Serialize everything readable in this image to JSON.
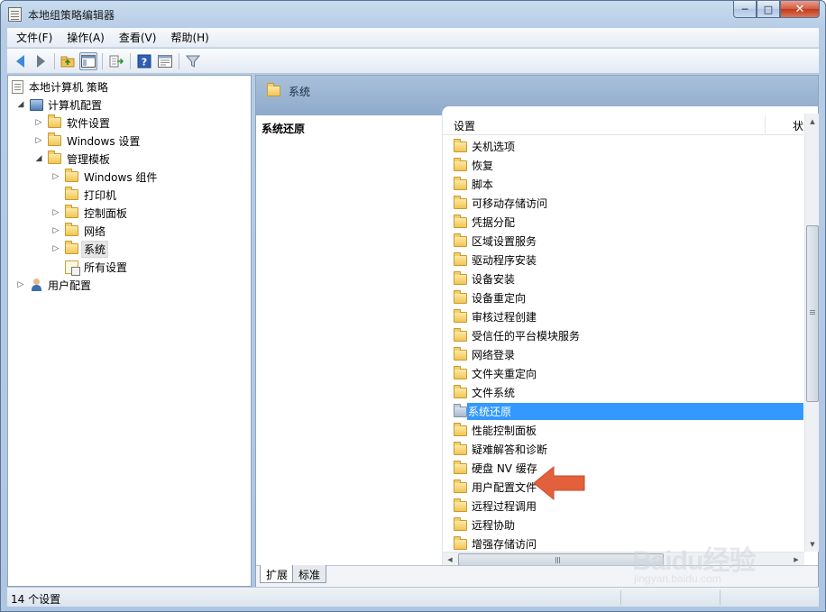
{
  "window": {
    "title": "本地组策略编辑器",
    "caption": {
      "minimize": "─",
      "maximize": "□",
      "close": "✕"
    }
  },
  "menu": [
    {
      "label": "文件(F)"
    },
    {
      "label": "操作(A)"
    },
    {
      "label": "查看(V)"
    },
    {
      "label": "帮助(H)"
    }
  ],
  "toolbar": {
    "icons": [
      "back-icon",
      "forward-icon",
      "up-folder-icon",
      "show-hide-tree-icon",
      "export-list-icon",
      "help-icon",
      "properties-icon",
      "filter-icon"
    ]
  },
  "tree": {
    "root": "本地计算机 策略",
    "computer_config": "计算机配置",
    "software_settings": "软件设置",
    "windows_settings": "Windows 设置",
    "admin_templates": "管理模板",
    "windows_components": "Windows 组件",
    "printers": "打印机",
    "control_panel": "控制面板",
    "network": "网络",
    "system": "系统",
    "all_settings": "所有设置",
    "user_config": "用户配置"
  },
  "right": {
    "header_title": "系统",
    "description_title": "系统还原",
    "columns": {
      "settings": "设置",
      "state": "状态"
    },
    "items": [
      {
        "label": "关机选项"
      },
      {
        "label": "恢复"
      },
      {
        "label": "脚本"
      },
      {
        "label": "可移动存储访问"
      },
      {
        "label": "凭据分配"
      },
      {
        "label": "区域设置服务"
      },
      {
        "label": "驱动程序安装"
      },
      {
        "label": "设备安装"
      },
      {
        "label": "设备重定向"
      },
      {
        "label": "审核过程创建"
      },
      {
        "label": "受信任的平台模块服务"
      },
      {
        "label": "网络登录"
      },
      {
        "label": "文件夹重定向"
      },
      {
        "label": "文件系统"
      },
      {
        "label": "系统还原",
        "selected": true
      },
      {
        "label": "性能控制面板"
      },
      {
        "label": "疑难解答和诊断"
      },
      {
        "label": "硬盘 NV 缓存"
      },
      {
        "label": "用户配置文件"
      },
      {
        "label": "远程过程调用"
      },
      {
        "label": "远程协助"
      },
      {
        "label": "增强存储访问"
      }
    ],
    "tabs": {
      "extended": "扩展",
      "standard": "标准"
    }
  },
  "status": {
    "text": "14 个设置"
  },
  "watermark": {
    "brand": "Baidu经验",
    "url": "jingyan.baidu.com"
  },
  "colors": {
    "selection": "#3399ff",
    "header_band": "#9bb4d2",
    "arrow": "#e2603c"
  }
}
